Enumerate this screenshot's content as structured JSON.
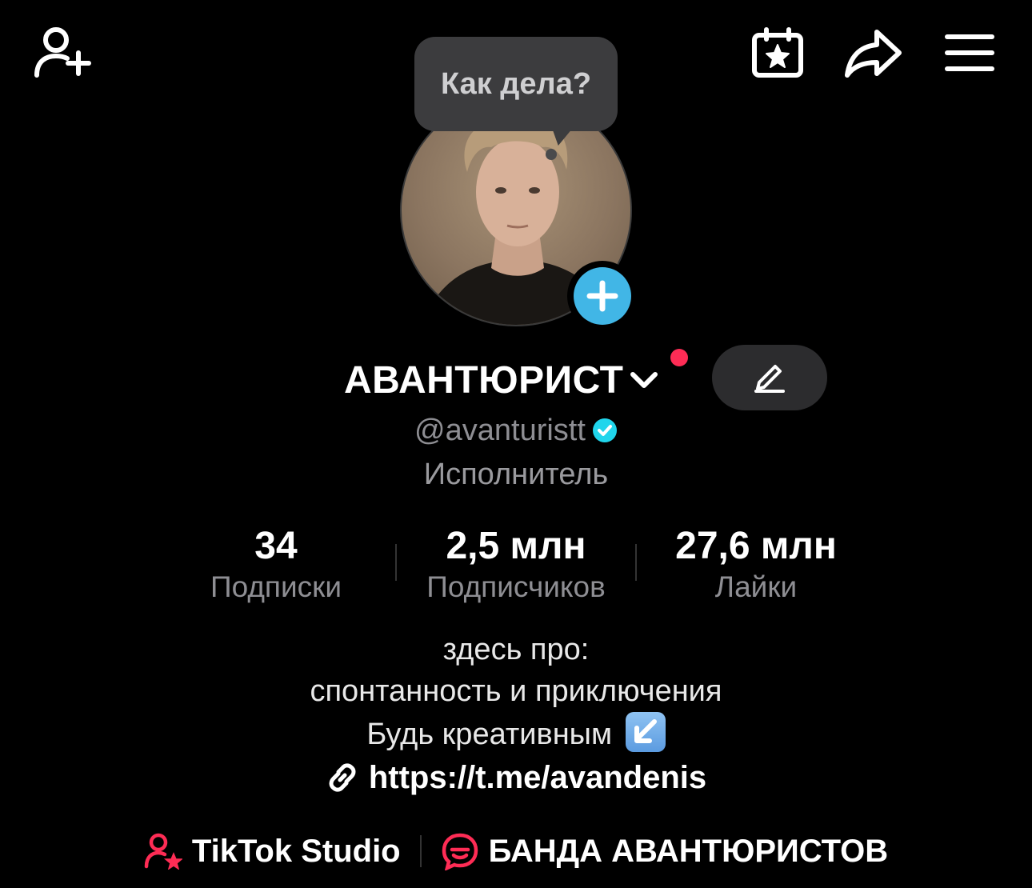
{
  "header": {
    "add_friend_icon": "person-plus-icon",
    "calendar_icon": "calendar-star-icon",
    "share_icon": "share-arrow-icon",
    "menu_icon": "hamburger-menu-icon"
  },
  "bubble": {
    "text": "Как дела?"
  },
  "profile": {
    "display_name": "АВАНТЮРИСТ",
    "username": "@avanturistt",
    "category": "Исполнитель",
    "verified": true
  },
  "stats": [
    {
      "value": "34",
      "label": "Подписки"
    },
    {
      "value": "2,5 млн",
      "label": "Подписчиков"
    },
    {
      "value": "27,6 млн",
      "label": "Лайки"
    }
  ],
  "bio": {
    "lines": [
      "здесь про:",
      "спонтанность и приключения",
      "Будь креативным"
    ],
    "link": "https://t.me/avandenis"
  },
  "bottom": {
    "studio": "TikTok Studio",
    "group": "БАНДА АВАНТЮРИСТОВ"
  },
  "colors": {
    "accent_red": "#fe2c55",
    "accent_blue": "#41b6e6",
    "verified_blue": "#20d5ec"
  }
}
